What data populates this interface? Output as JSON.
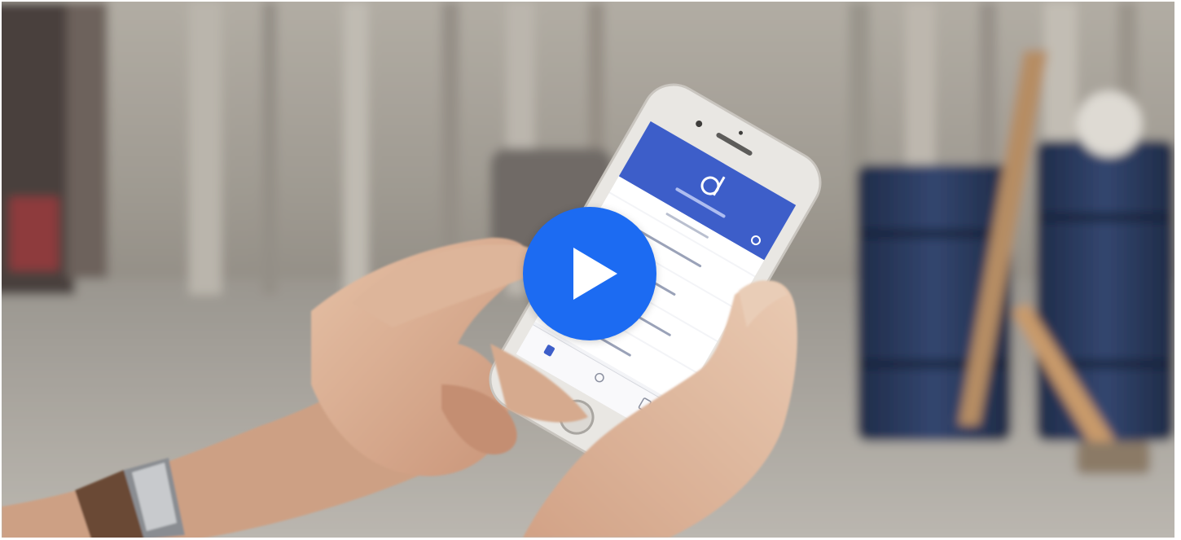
{
  "video": {
    "play_label": "",
    "colors": {
      "play_button": "#1c6bf2",
      "app_header": "#3d5ec9",
      "barrel": "#2a3a63"
    },
    "icons": [
      "play-icon",
      "app-logo-icon",
      "search-icon",
      "home-tab-icon",
      "profile-tab-icon",
      "docs-tab-icon"
    ]
  }
}
